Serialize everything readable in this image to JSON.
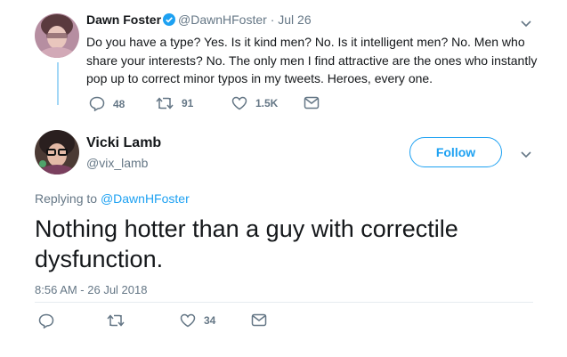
{
  "parent_tweet": {
    "author_name": "Dawn Foster",
    "verified": true,
    "handle": "@DawnHFoster",
    "separator": "·",
    "date": "Jul 26",
    "text": "Do you have a type? Yes. Is it kind men? No. Is it intelligent men? No. Men who share your interests? No. The only men I find attractive are the ones who instantly pop up to correct minor typos in my tweets. Heroes, every one.",
    "replies": "48",
    "retweets": "91",
    "likes": "1.5K"
  },
  "main_tweet": {
    "author_name": "Vicki Lamb",
    "handle": "@vix_lamb",
    "follow_label": "Follow",
    "replying_prefix": "Replying to",
    "replying_to": "@DawnHFoster",
    "text": "Nothing hotter than a guy with correctile dysfunction.",
    "timestamp": "8:56 AM - 26 Jul 2018",
    "likes": "34"
  },
  "colors": {
    "accent": "#1da1f2",
    "muted": "#657786",
    "thread_line": "#a3d7f6"
  },
  "icons": {
    "reply": "reply-icon",
    "retweet": "retweet-icon",
    "like": "heart-icon",
    "message": "envelope-icon",
    "more": "chevron-down-icon",
    "verified": "verified-badge-icon"
  }
}
